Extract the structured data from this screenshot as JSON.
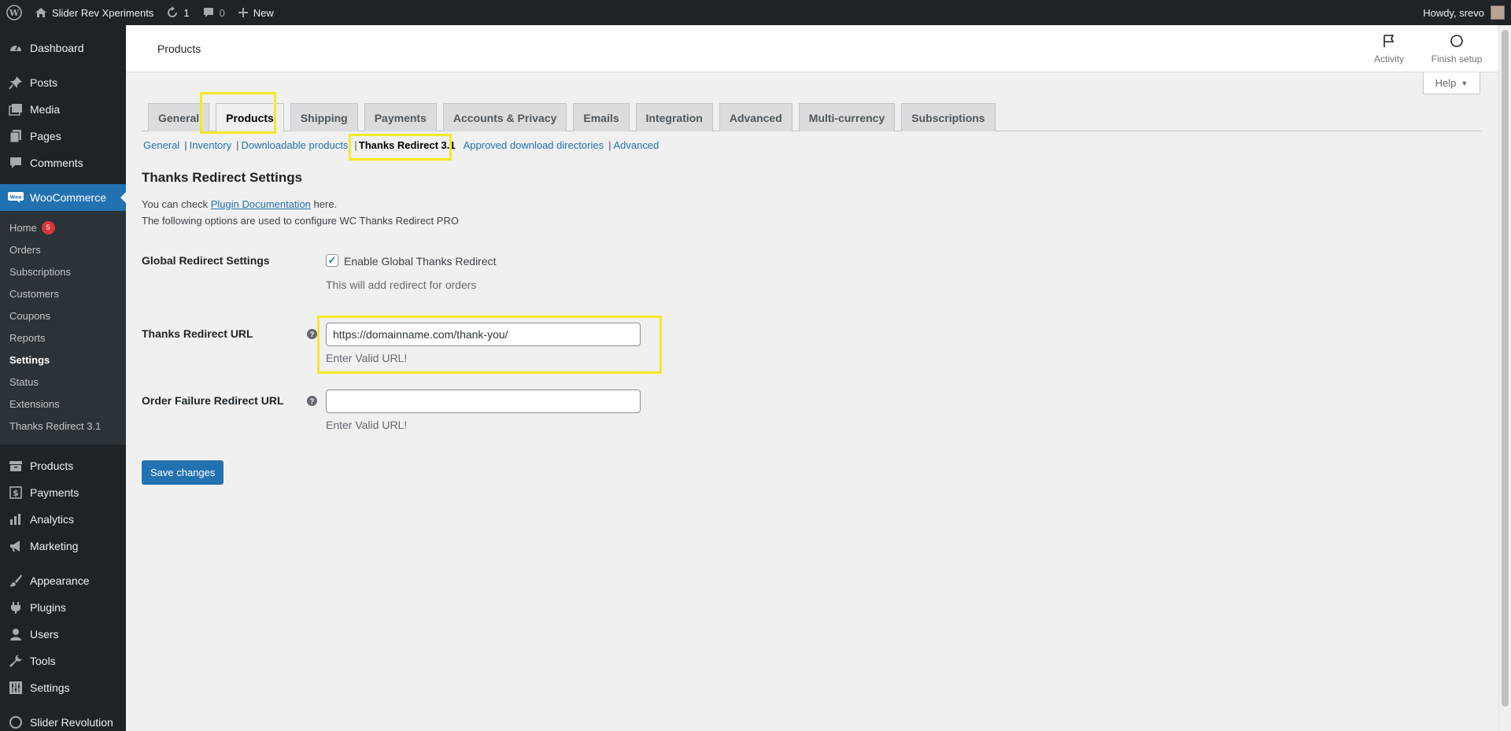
{
  "adminbar": {
    "site_name": "Slider Rev Xperiments",
    "updates_count": "1",
    "comments_count": "0",
    "new_label": "New",
    "howdy": "Howdy, srevo"
  },
  "sidebar": {
    "top": [
      {
        "label": "Dashboard",
        "icon": "dashboard-icon"
      },
      {
        "label": "Posts",
        "icon": "pin-icon"
      },
      {
        "label": "Media",
        "icon": "media-icon"
      },
      {
        "label": "Pages",
        "icon": "pages-icon"
      },
      {
        "label": "Comments",
        "icon": "comment-icon"
      }
    ],
    "woocommerce": "WooCommerce",
    "submenu": [
      {
        "label": "Home",
        "badge": "5"
      },
      {
        "label": "Orders"
      },
      {
        "label": "Subscriptions"
      },
      {
        "label": "Customers"
      },
      {
        "label": "Coupons"
      },
      {
        "label": "Reports"
      },
      {
        "label": "Settings"
      },
      {
        "label": "Status"
      },
      {
        "label": "Extensions"
      },
      {
        "label": "Thanks Redirect 3.1"
      }
    ],
    "bottom": [
      {
        "label": "Products"
      },
      {
        "label": "Payments"
      },
      {
        "label": "Analytics"
      },
      {
        "label": "Marketing"
      },
      {
        "label": "Appearance"
      },
      {
        "label": "Plugins"
      },
      {
        "label": "Users"
      },
      {
        "label": "Tools"
      },
      {
        "label": "Settings"
      },
      {
        "label": "Slider Revolution"
      }
    ]
  },
  "header": {
    "title": "Products",
    "activity": "Activity",
    "finish_setup": "Finish setup",
    "help": "Help"
  },
  "tabs": [
    "General",
    "Products",
    "Shipping",
    "Payments",
    "Accounts & Privacy",
    "Emails",
    "Integration",
    "Advanced",
    "Multi-currency",
    "Subscriptions"
  ],
  "active_tab": "Products",
  "subsub": {
    "general": "General",
    "inventory": "Inventory",
    "downloadable": "Downloadable products",
    "thanks": "Thanks Redirect 3.1",
    "approved": "Approved download directories",
    "advanced": "Advanced"
  },
  "settings": {
    "title": "Thanks Redirect Settings",
    "check_prefix": "You can check",
    "doc_link": "Plugin Documentation",
    "check_suffix": "here.",
    "intro": "The following options are used to configure WC Thanks Redirect PRO",
    "global_label": "Global Redirect Settings",
    "enable_label": "Enable Global Thanks Redirect",
    "enable_checked": true,
    "enable_desc": "This will add redirect for orders",
    "url_label": "Thanks Redirect URL",
    "url_value": "https://domainname.com/thank-you/",
    "url_desc": "Enter Valid URL!",
    "fail_label": "Order Failure Redirect URL",
    "fail_value": "",
    "fail_desc": "Enter Valid URL!",
    "save": "Save changes"
  },
  "colors": {
    "admin_dark": "#1d2327",
    "accent": "#2271b1",
    "highlight": "#f5e82a",
    "badge": "#d63638"
  }
}
